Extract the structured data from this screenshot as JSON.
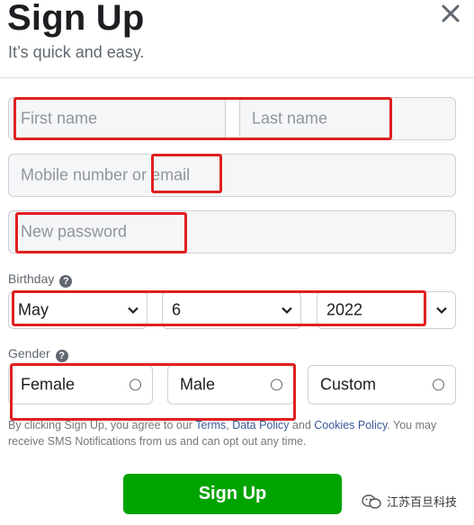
{
  "header": {
    "title": "Sign Up",
    "subtitle": "It’s quick and easy."
  },
  "form": {
    "first_name_placeholder": "First name",
    "last_name_placeholder": "Last name",
    "mobile_email_placeholder": "Mobile number or email",
    "password_placeholder": "New password"
  },
  "birthday": {
    "label": "Birthday",
    "month": "May",
    "day": "6",
    "year": "2022"
  },
  "gender": {
    "label": "Gender",
    "options": [
      "Female",
      "Male",
      "Custom"
    ]
  },
  "terms": {
    "prefix": "By clicking Sign Up, you agree to our ",
    "terms_link": "Terms",
    "sep1": ", ",
    "data_policy_link": "Data Policy",
    "sep2": " and ",
    "cookies_link": "Cookies Policy",
    "suffix": ". You may receive SMS Notifications from us and can opt out any time."
  },
  "signup_button": "Sign Up",
  "watermark": "江苏百旦科技",
  "colors": {
    "primary_button": "#00a400",
    "link": "#385898",
    "annotation": "#e02020"
  }
}
